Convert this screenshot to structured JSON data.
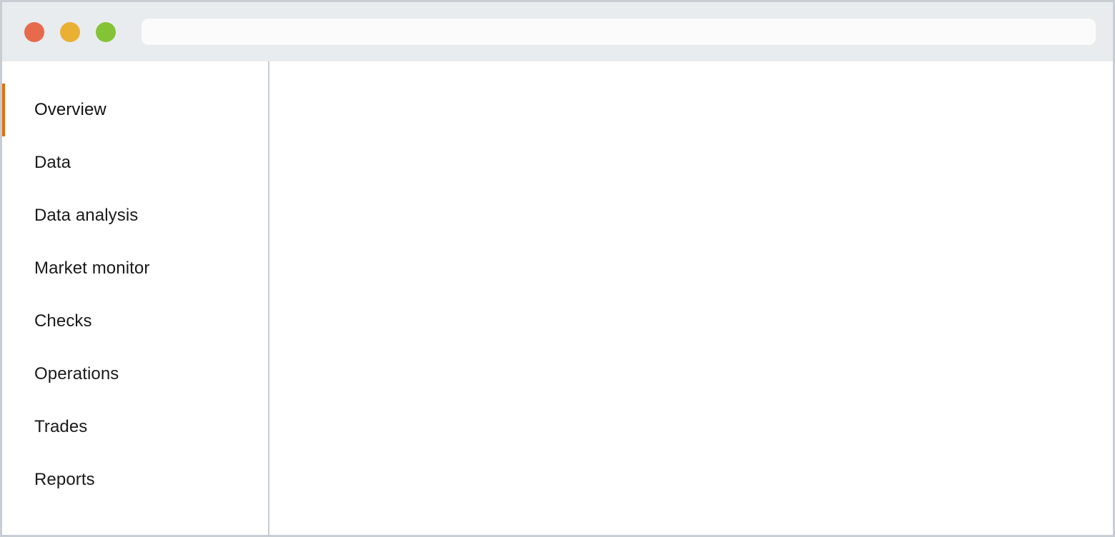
{
  "window": {
    "titlebar": {
      "traffic_lights": [
        {
          "name": "close-button",
          "color": "#e86a4c",
          "label": "Close"
        },
        {
          "name": "minimize-button",
          "color": "#eab034",
          "label": "Minimize"
        },
        {
          "name": "maximize-button",
          "color": "#84c336",
          "label": "Maximize"
        }
      ],
      "address_bar": {
        "value": "",
        "placeholder": ""
      }
    },
    "colors": {
      "titlebar_background": "#e8ecef",
      "window_border": "#c8cdd4",
      "address_bar_background": "#fbfbfb",
      "active_indicator": "#e2700e",
      "content_background": "#ffffff",
      "sidebar_divider": "#c8cdd4",
      "nav_label": "#1a1a1a"
    },
    "sidebar": {
      "items": [
        {
          "label": "Overview",
          "name": "sidebar-item-overview",
          "active": true
        },
        {
          "label": "Data",
          "name": "sidebar-item-data",
          "active": false
        },
        {
          "label": "Data analysis",
          "name": "sidebar-item-data-analysis",
          "active": false
        },
        {
          "label": "Market monitor",
          "name": "sidebar-item-market-monitor",
          "active": false
        },
        {
          "label": "Checks",
          "name": "sidebar-item-checks",
          "active": false
        },
        {
          "label": "Operations",
          "name": "sidebar-item-operations",
          "active": false
        },
        {
          "label": "Trades",
          "name": "sidebar-item-trades",
          "active": false
        },
        {
          "label": "Reports",
          "name": "sidebar-item-reports",
          "active": false
        }
      ]
    },
    "content": {
      "body_text": ""
    }
  }
}
